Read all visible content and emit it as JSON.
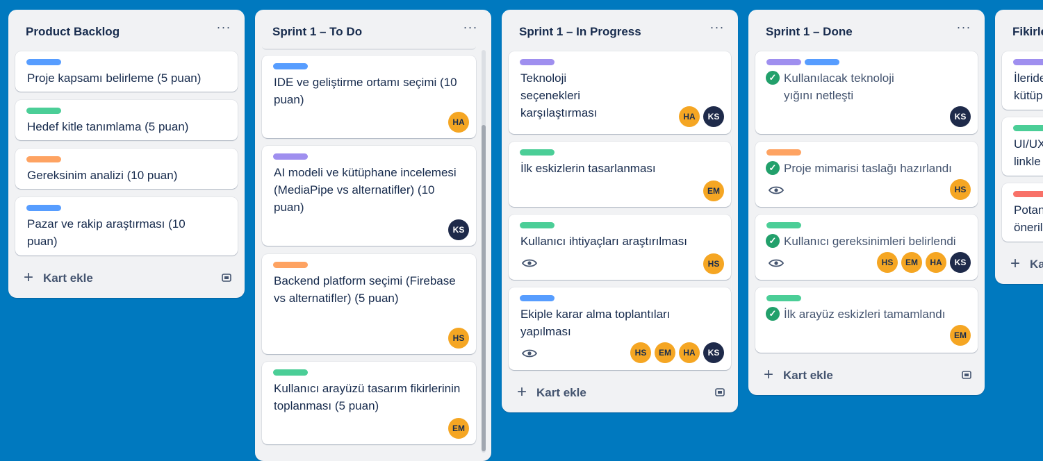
{
  "lists": [
    {
      "title": "Product Backlog",
      "menu": "···",
      "cards": [
        {
          "labels": [
            "#579dff"
          ],
          "title": "Proje kapsamı belirleme (5 puan)"
        },
        {
          "labels": [
            "#4bce97"
          ],
          "title": "Hedef kitle tanımlama (5 puan)"
        },
        {
          "labels": [
            "#fea362"
          ],
          "title": "Gereksinim analizi (10 puan)"
        },
        {
          "labels": [
            "#579dff"
          ],
          "title": "Pazar ve rakip araştırması (10 puan)"
        }
      ],
      "add_label": "Kart ekle"
    },
    {
      "title": "Sprint 1 – To Do",
      "menu": "···",
      "cards": [
        {
          "labels": [
            "#579dff"
          ],
          "title": "IDE ve geliştirme ortamı seçimi (10 puan)",
          "members": [
            "HA"
          ]
        },
        {
          "labels": [
            "#9f8fef"
          ],
          "title": "AI modeli ve kütüphane incelemesi (MediaPipe vs alternatifler) (10 puan)",
          "members": [
            "KS"
          ]
        },
        {
          "labels": [
            "#fea362"
          ],
          "title": "Backend platform seçimi (Firebase vs alternatifler) (5 puan)",
          "members": [
            "HS"
          ]
        },
        {
          "labels": [
            "#4bce97"
          ],
          "title": "Kullanıcı arayüzü tasarım fikirlerinin toplanması (5 puan)",
          "members": [
            "EM"
          ]
        }
      ]
    },
    {
      "title": "Sprint 1 – In Progress",
      "menu": "···",
      "cards": [
        {
          "labels": [
            "#9f8fef"
          ],
          "title": "Teknoloji seçenekleri karşılaştırması",
          "members": [
            "HA",
            "KS"
          ]
        },
        {
          "labels": [
            "#4bce97"
          ],
          "title": "İlk eskizlerin tasarlanması",
          "members": [
            "EM"
          ]
        },
        {
          "labels": [
            "#4bce97"
          ],
          "title": "Kullanıcı ihtiyaçları araştırılması",
          "members": [
            "HS"
          ],
          "watch": true
        },
        {
          "labels": [
            "#579dff"
          ],
          "title": "Ekiple karar alma toplantıları yapılması",
          "members": [
            "HS",
            "EM",
            "HA",
            "KS"
          ],
          "watch": true
        }
      ],
      "add_label": "Kart ekle"
    },
    {
      "title": "Sprint 1 – Done",
      "menu": "···",
      "cards": [
        {
          "labels": [
            "#9f8fef",
            "#579dff"
          ],
          "title": "Kullanılacak teknoloji yığını netleşti",
          "members": [
            "KS"
          ]
        },
        {
          "labels": [
            "#fea362"
          ],
          "title": "Proje mimarisi taslağı hazırlandı",
          "members": [
            "HS"
          ],
          "watch": true
        },
        {
          "labels": [
            "#4bce97"
          ],
          "title": "Kullanıcı gereksinimleri belirlendi",
          "members": [
            "HS",
            "EM",
            "HA",
            "KS"
          ],
          "watch": true
        },
        {
          "labels": [
            "#4bce97"
          ],
          "title": "İlk arayüz eskizleri tamamlandı",
          "members": [
            "EM"
          ]
        }
      ],
      "add_label": "Kart ekle"
    },
    {
      "title": "Fikirle",
      "cards": [
        {
          "labels": [
            "#9f8fef"
          ],
          "title": "İleride kütüp"
        },
        {
          "labels": [
            "#4bce97"
          ],
          "title": "UI/UX linkle"
        },
        {
          "labels": [
            "#f87168"
          ],
          "title": "Potan öneril"
        }
      ],
      "add_label": "Ka"
    }
  ],
  "avatar_colors": {
    "HA": "orange",
    "HS": "orange",
    "EM": "orange",
    "KS": "navy"
  },
  "colors": {
    "board_bg": "#0079bf",
    "list_bg": "#f1f2f4",
    "done_check": "#22a06b"
  }
}
